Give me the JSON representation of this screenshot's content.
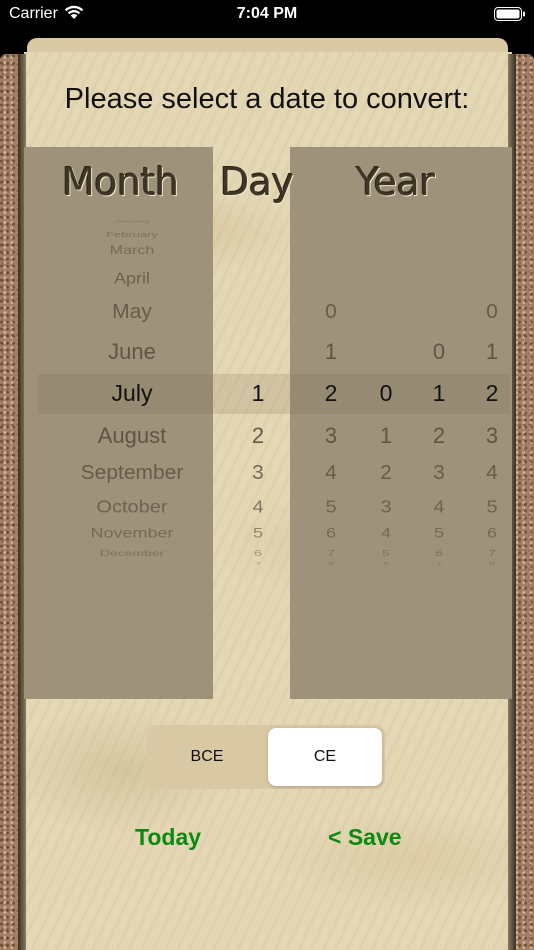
{
  "status_bar": {
    "carrier": "Carrier",
    "time": "7:04 PM"
  },
  "title": "Please select a date to convert:",
  "columns": {
    "month": "Month",
    "day": "Day",
    "year": "Year"
  },
  "months": {
    "items": [
      "January",
      "February",
      "March",
      "April",
      "May",
      "June",
      "July",
      "August",
      "September",
      "October",
      "November",
      "December"
    ],
    "selected": "July"
  },
  "days": {
    "items": [
      "1",
      "2",
      "3",
      "4",
      "5",
      "6",
      "7"
    ],
    "selected": "1"
  },
  "year_digits": [
    {
      "items": [
        "0",
        "1",
        "2",
        "3",
        "4",
        "5",
        "6",
        "7",
        "8"
      ],
      "selected": "2"
    },
    {
      "items": [
        "0",
        "1",
        "2",
        "3",
        "4",
        "5",
        "6"
      ],
      "selected": "0"
    },
    {
      "items": [
        "0",
        "1",
        "2",
        "3",
        "4",
        "5",
        "6",
        "7"
      ],
      "selected": "1"
    },
    {
      "items": [
        "0",
        "1",
        "2",
        "3",
        "4",
        "5",
        "6",
        "7",
        "8"
      ],
      "selected": "2"
    }
  ],
  "era": {
    "options": [
      "BCE",
      "CE"
    ],
    "selected": "CE"
  },
  "actions": {
    "today": "Today",
    "save": "< Save"
  },
  "colors": {
    "accent_green": "#0b8a12",
    "wheel_gray": "#9e927a",
    "parchment": "#e4d7b4"
  }
}
